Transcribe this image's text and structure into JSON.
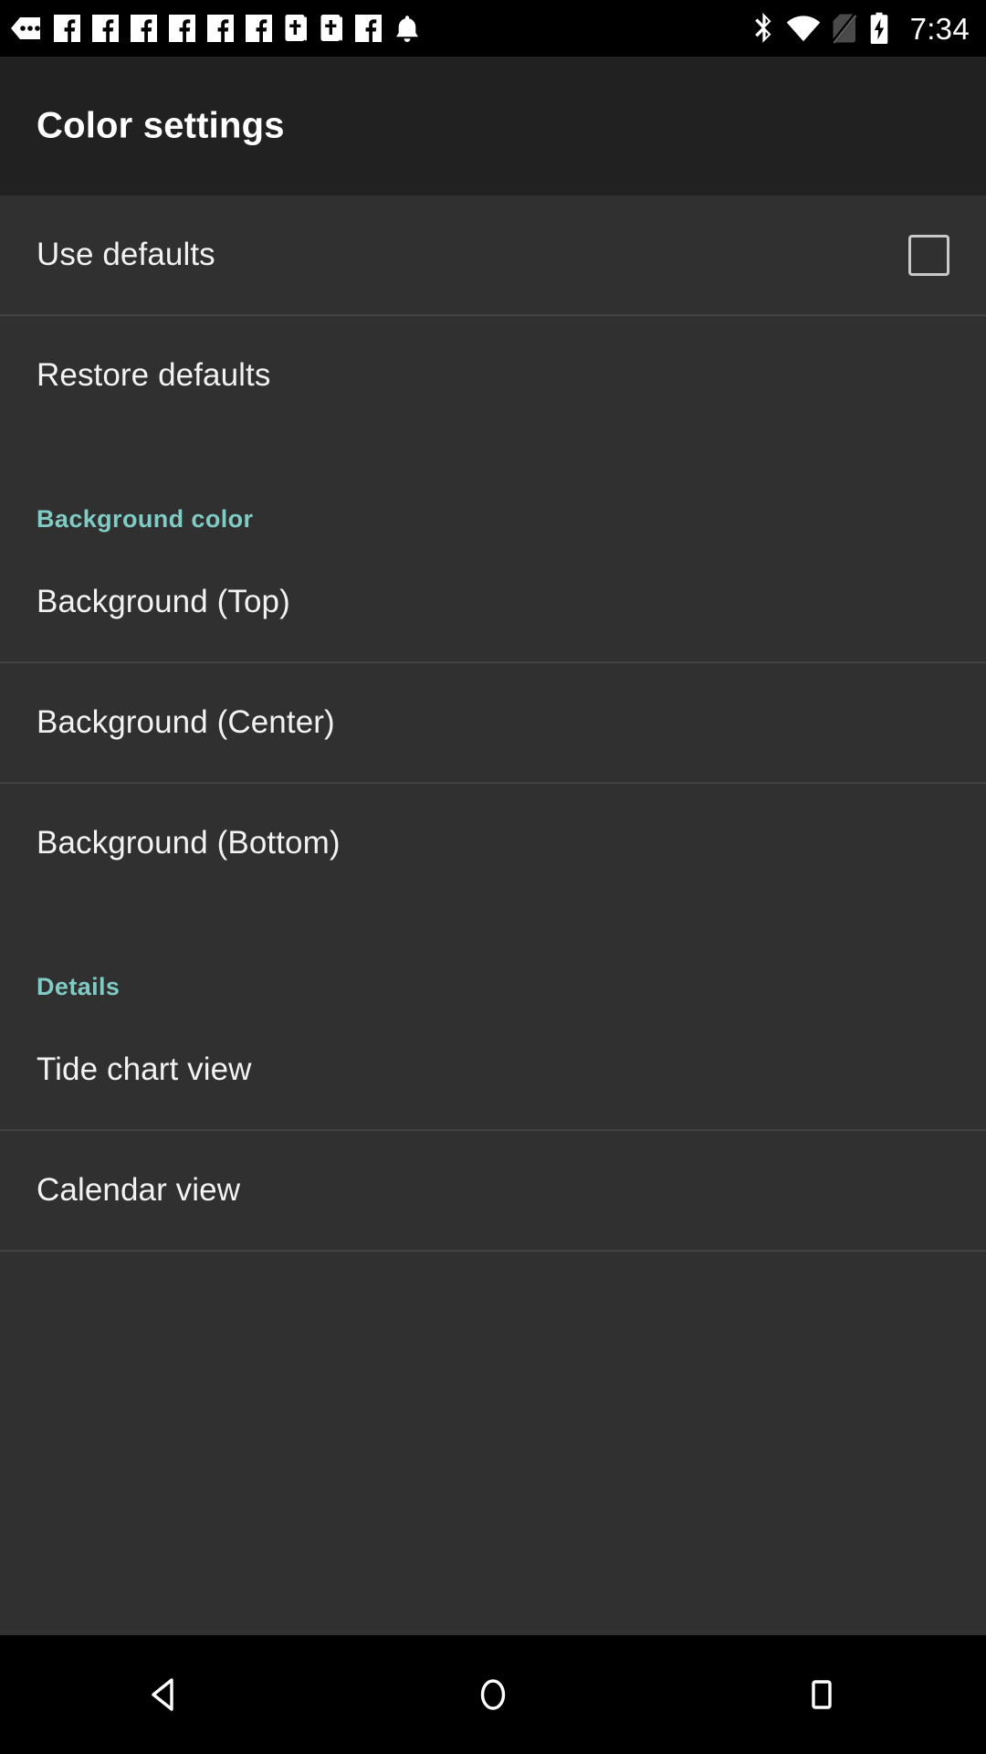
{
  "status_bar": {
    "notification_icons": [
      "more-notifications-icon",
      "facebook-icon",
      "facebook-icon",
      "facebook-icon",
      "facebook-icon",
      "facebook-icon",
      "facebook-icon",
      "bible-icon",
      "bible-icon",
      "facebook-icon",
      "bell-icon"
    ],
    "system_icons": [
      "bluetooth-icon",
      "wifi-icon",
      "no-sim-icon",
      "battery-charging-icon"
    ],
    "clock": "7:34"
  },
  "header": {
    "title": "Color settings"
  },
  "list": [
    {
      "kind": "row",
      "label": "Use defaults",
      "name": "use-defaults",
      "control": "checkbox",
      "checked": false
    },
    {
      "kind": "divider"
    },
    {
      "kind": "row",
      "label": "Restore defaults",
      "name": "restore-defaults",
      "control": "none"
    },
    {
      "kind": "section",
      "label": "Background color",
      "name": "background-color"
    },
    {
      "kind": "row",
      "label": "Background (Top)",
      "name": "background-top",
      "control": "none"
    },
    {
      "kind": "divider"
    },
    {
      "kind": "row",
      "label": "Background (Center)",
      "name": "background-center",
      "control": "none"
    },
    {
      "kind": "divider"
    },
    {
      "kind": "row",
      "label": "Background (Bottom)",
      "name": "background-bottom",
      "control": "none"
    },
    {
      "kind": "section",
      "label": "Details",
      "name": "details"
    },
    {
      "kind": "row",
      "label": "Tide chart view",
      "name": "tide-chart-view",
      "control": "none"
    },
    {
      "kind": "divider"
    },
    {
      "kind": "row",
      "label": "Calendar view",
      "name": "calendar-view",
      "control": "none"
    },
    {
      "kind": "divider"
    }
  ],
  "nav_bar": {
    "buttons": [
      "back-icon",
      "home-icon",
      "recents-icon"
    ]
  },
  "colors": {
    "status_bar_bg": "#000000",
    "header_bg": "#212121",
    "list_bg": "#303030",
    "divider": "#474747",
    "primary_text": "#f2f2f2",
    "accent_teal": "#80CBC4",
    "checkbox_border": "#c9c9c9"
  }
}
